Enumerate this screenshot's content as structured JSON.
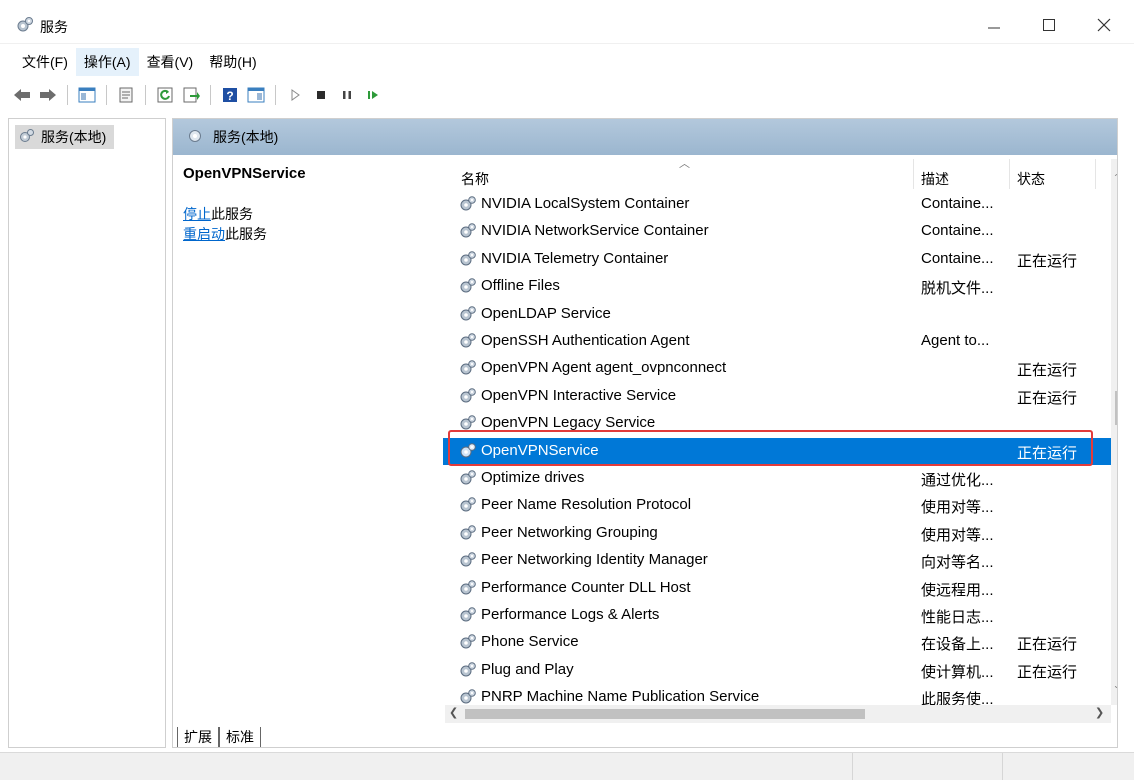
{
  "window": {
    "title": "服务",
    "icon": "gear-icon"
  },
  "menu": {
    "items": [
      {
        "label": "文件(F)"
      },
      {
        "label": "操作(A)"
      },
      {
        "label": "查看(V)"
      },
      {
        "label": "帮助(H)"
      }
    ]
  },
  "tree": {
    "root_label": "服务(本地)"
  },
  "content": {
    "header_title": "服务(本地)",
    "selected_service": "OpenVPNService",
    "actions": [
      {
        "link": "停止",
        "rest": "此服务"
      },
      {
        "link": "重启动",
        "rest": "此服务"
      }
    ]
  },
  "list": {
    "columns": {
      "name": "名称",
      "description": "描述",
      "status": "状态"
    },
    "rows": [
      {
        "name": "NVIDIA LocalSystem Container",
        "description": "Containe...",
        "status": ""
      },
      {
        "name": "NVIDIA NetworkService Container",
        "description": "Containe...",
        "status": ""
      },
      {
        "name": "NVIDIA Telemetry Container",
        "description": "Containe...",
        "status": "正在运行"
      },
      {
        "name": "Offline Files",
        "description": "脱机文件...",
        "status": ""
      },
      {
        "name": "OpenLDAP Service",
        "description": "",
        "status": ""
      },
      {
        "name": "OpenSSH Authentication Agent",
        "description": "Agent to...",
        "status": ""
      },
      {
        "name": "OpenVPN Agent agent_ovpnconnect",
        "description": "",
        "status": "正在运行"
      },
      {
        "name": "OpenVPN Interactive Service",
        "description": "",
        "status": "正在运行"
      },
      {
        "name": "OpenVPN Legacy Service",
        "description": "",
        "status": ""
      },
      {
        "name": "OpenVPNService",
        "description": "",
        "status": "正在运行",
        "selected": true
      },
      {
        "name": "Optimize drives",
        "description": "通过优化...",
        "status": ""
      },
      {
        "name": "Peer Name Resolution Protocol",
        "description": "使用对等...",
        "status": ""
      },
      {
        "name": "Peer Networking Grouping",
        "description": "使用对等...",
        "status": ""
      },
      {
        "name": "Peer Networking Identity Manager",
        "description": "向对等名...",
        "status": ""
      },
      {
        "name": "Performance Counter DLL Host",
        "description": "使远程用...",
        "status": ""
      },
      {
        "name": "Performance Logs & Alerts",
        "description": "性能日志...",
        "status": ""
      },
      {
        "name": "Phone Service",
        "description": "在设备上...",
        "status": "正在运行"
      },
      {
        "name": "Plug and Play",
        "description": "使计算机...",
        "status": "正在运行"
      },
      {
        "name": "PNRP Machine Name Publication Service",
        "description": "此服务使...",
        "status": ""
      }
    ]
  },
  "tabs": [
    {
      "label": "扩展"
    },
    {
      "label": "标准"
    }
  ],
  "colors": {
    "selection": "#0078d7",
    "highlight_border": "#e23b3b",
    "header_band": "#a9c0d6",
    "link": "#0066cc"
  }
}
